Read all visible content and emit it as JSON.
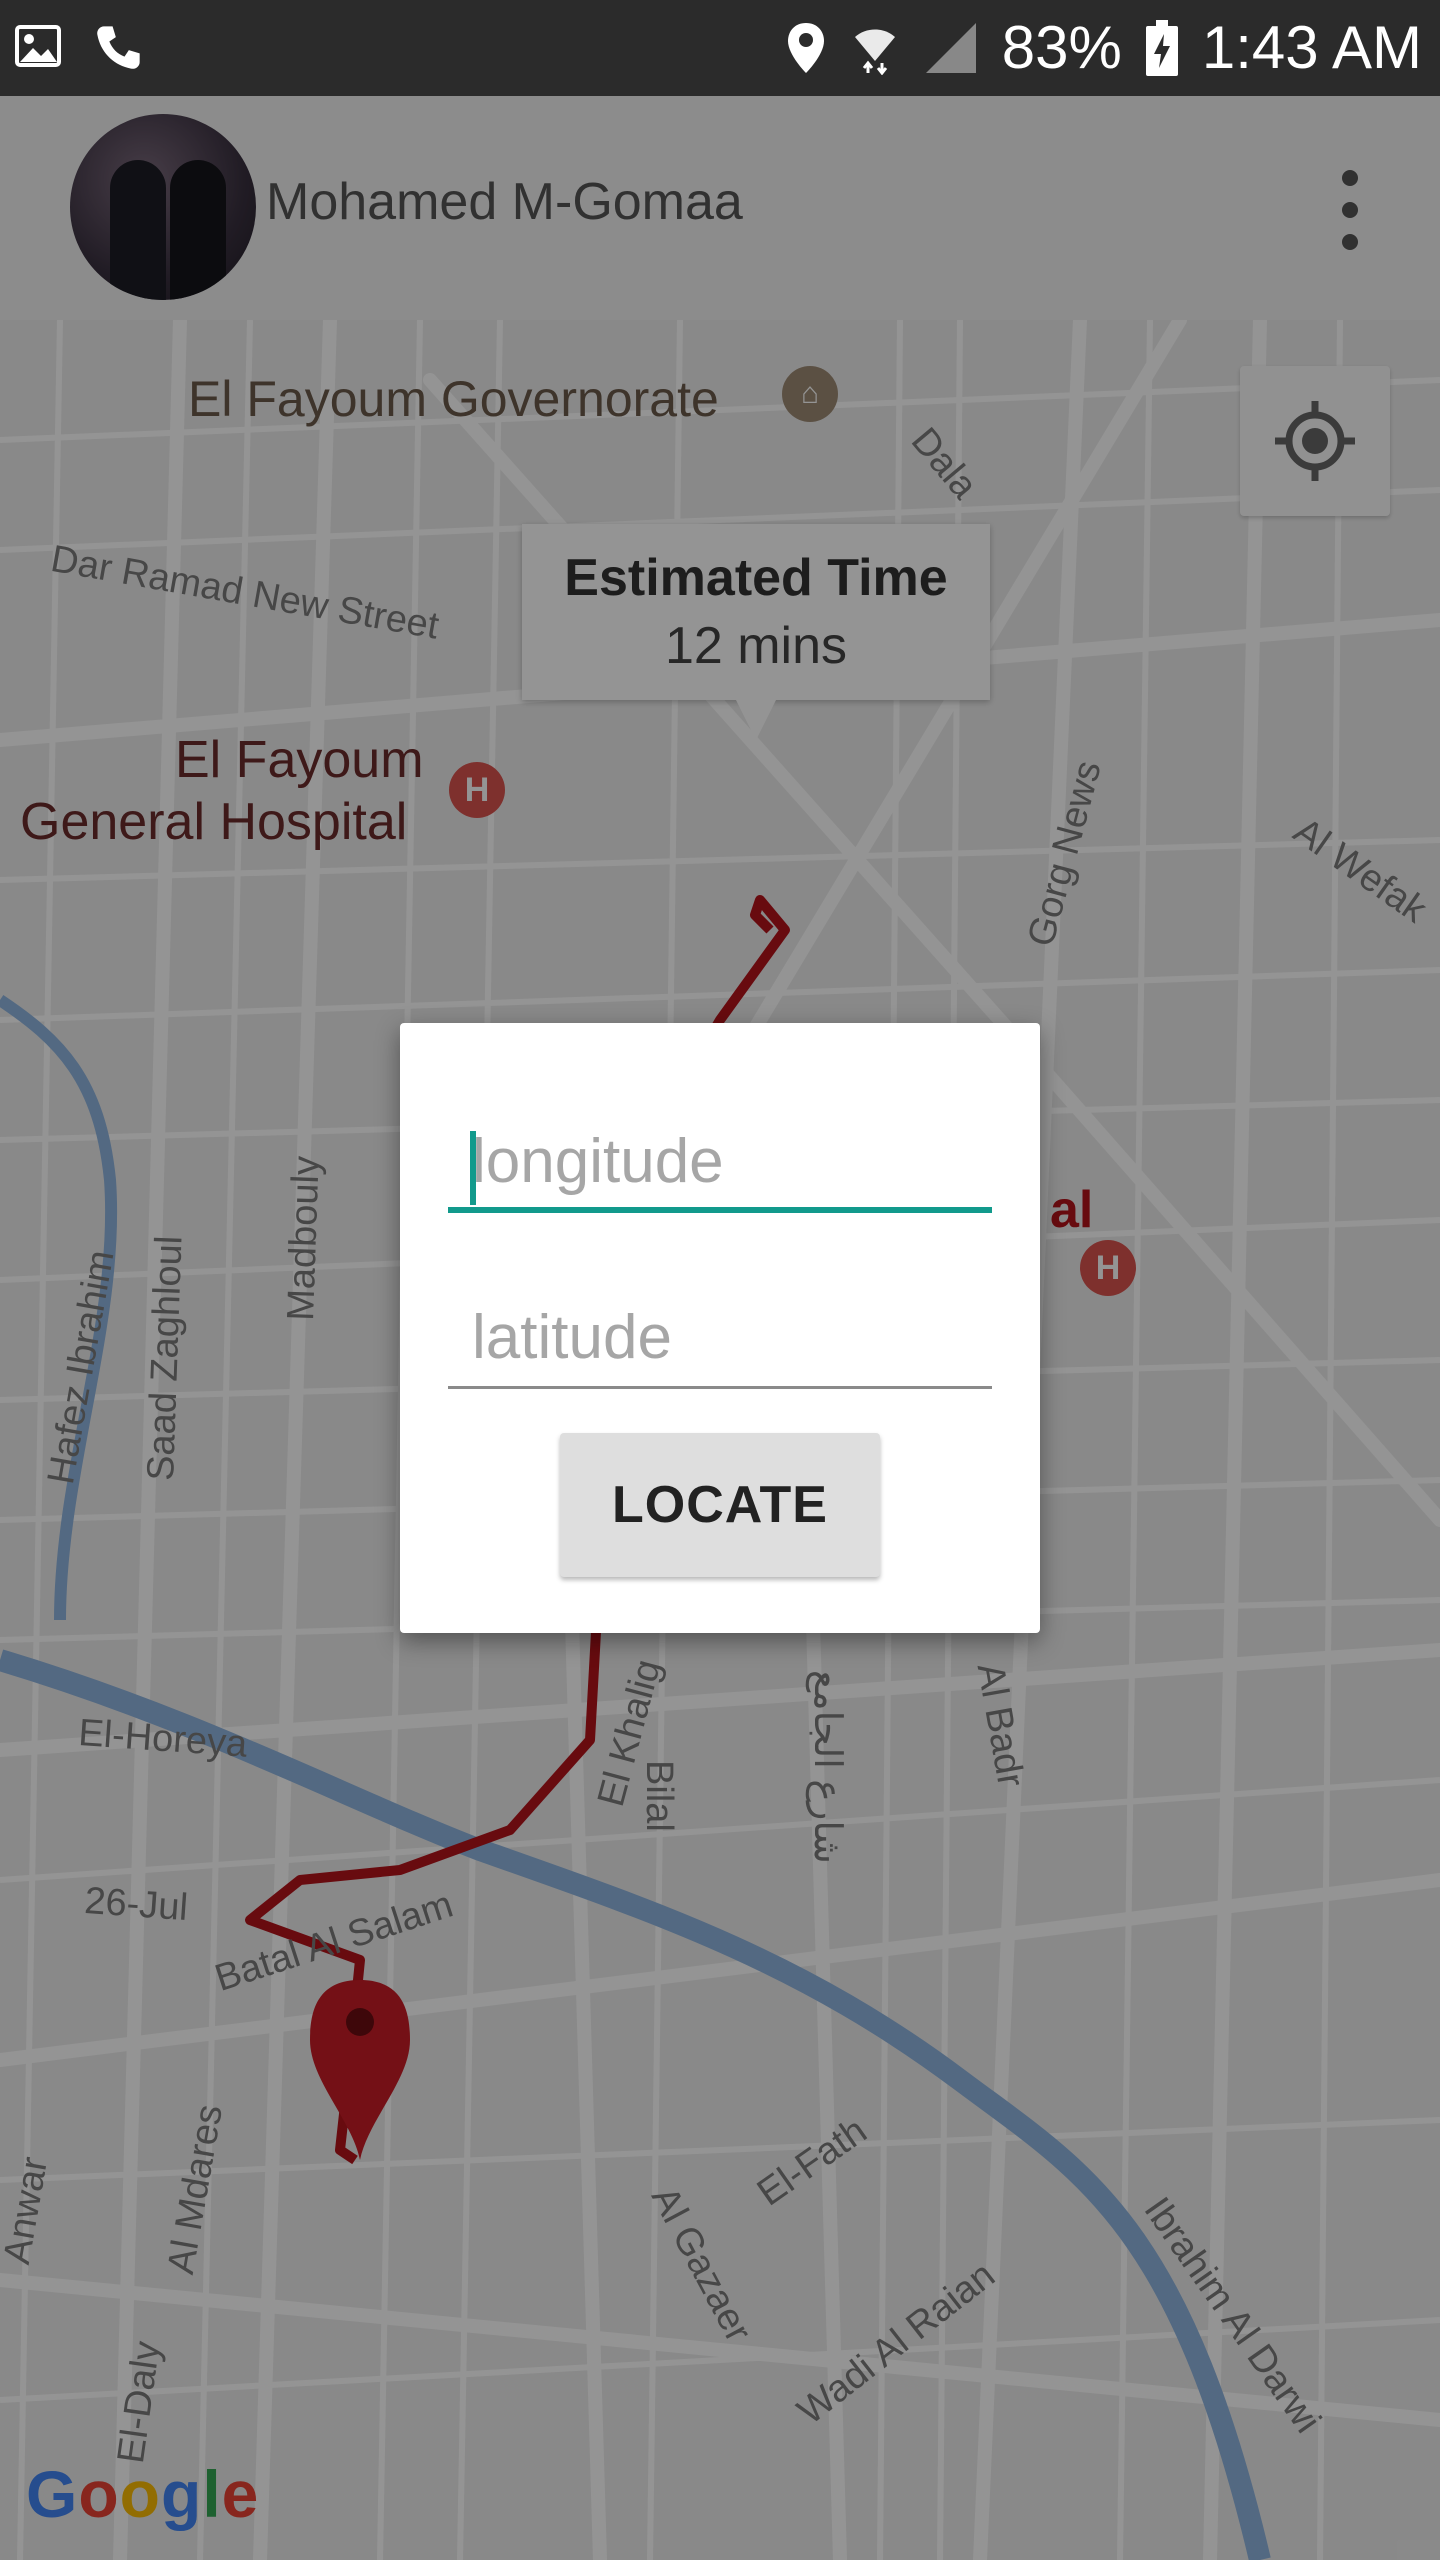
{
  "status_bar": {
    "battery": "83%",
    "time": "1:43 AM",
    "icons": [
      "image-icon",
      "phone-icon",
      "location-icon",
      "wifi-icon",
      "signal-icon",
      "battery-charging-icon"
    ]
  },
  "app_bar": {
    "user_name": "Mohamed M-Gomaa",
    "overflow_icon": "more-vert-icon"
  },
  "map": {
    "labels": {
      "governorate": "El Fayoum Governorate",
      "dar_ramad": "Dar Ramad New Street",
      "dala": "Dala",
      "hospital_1": "El Fayoum",
      "hospital_2": "General Hospital",
      "gorg_news": "Gorg News",
      "al_wefak": "Al Wefak",
      "hafez": "Hafez Ibrahim",
      "saad": "Saad Zaghloul",
      "madbouly": "Madbouly",
      "el_horeya": "El-Horeya",
      "jul26": "26-Jul",
      "batal": "Batal Al Salam",
      "el_khalig": "El Khalig",
      "bilal": "Bilal",
      "al_gamea": "شارع الجامع",
      "al_badr": "Al Badr",
      "el_fath": "El-Fath",
      "al_gazaer": "Al Gazaer",
      "wadi": "Wadi Al Raian",
      "ibrahim": "Ibrahim Al Darwi",
      "al_mdares": "Al Mdares",
      "el_daly": "El-Daly",
      "anwar": "Anwar",
      "poi_h": "H",
      "partial_al": "al"
    },
    "info_window": {
      "title": "Estimated Time",
      "value": "12 mins"
    },
    "my_location_icon": "my-location-icon",
    "logo": "Google",
    "colors": {
      "route": "#b3131b",
      "water": "#8fb5e0",
      "road": "#ffffff",
      "hospital": "#d9534f"
    }
  },
  "dialog": {
    "longitude_placeholder": "longitude",
    "latitude_placeholder": "latitude",
    "longitude_value": "",
    "latitude_value": "",
    "button_label": "LOCATE",
    "accent": "#129a8c"
  }
}
